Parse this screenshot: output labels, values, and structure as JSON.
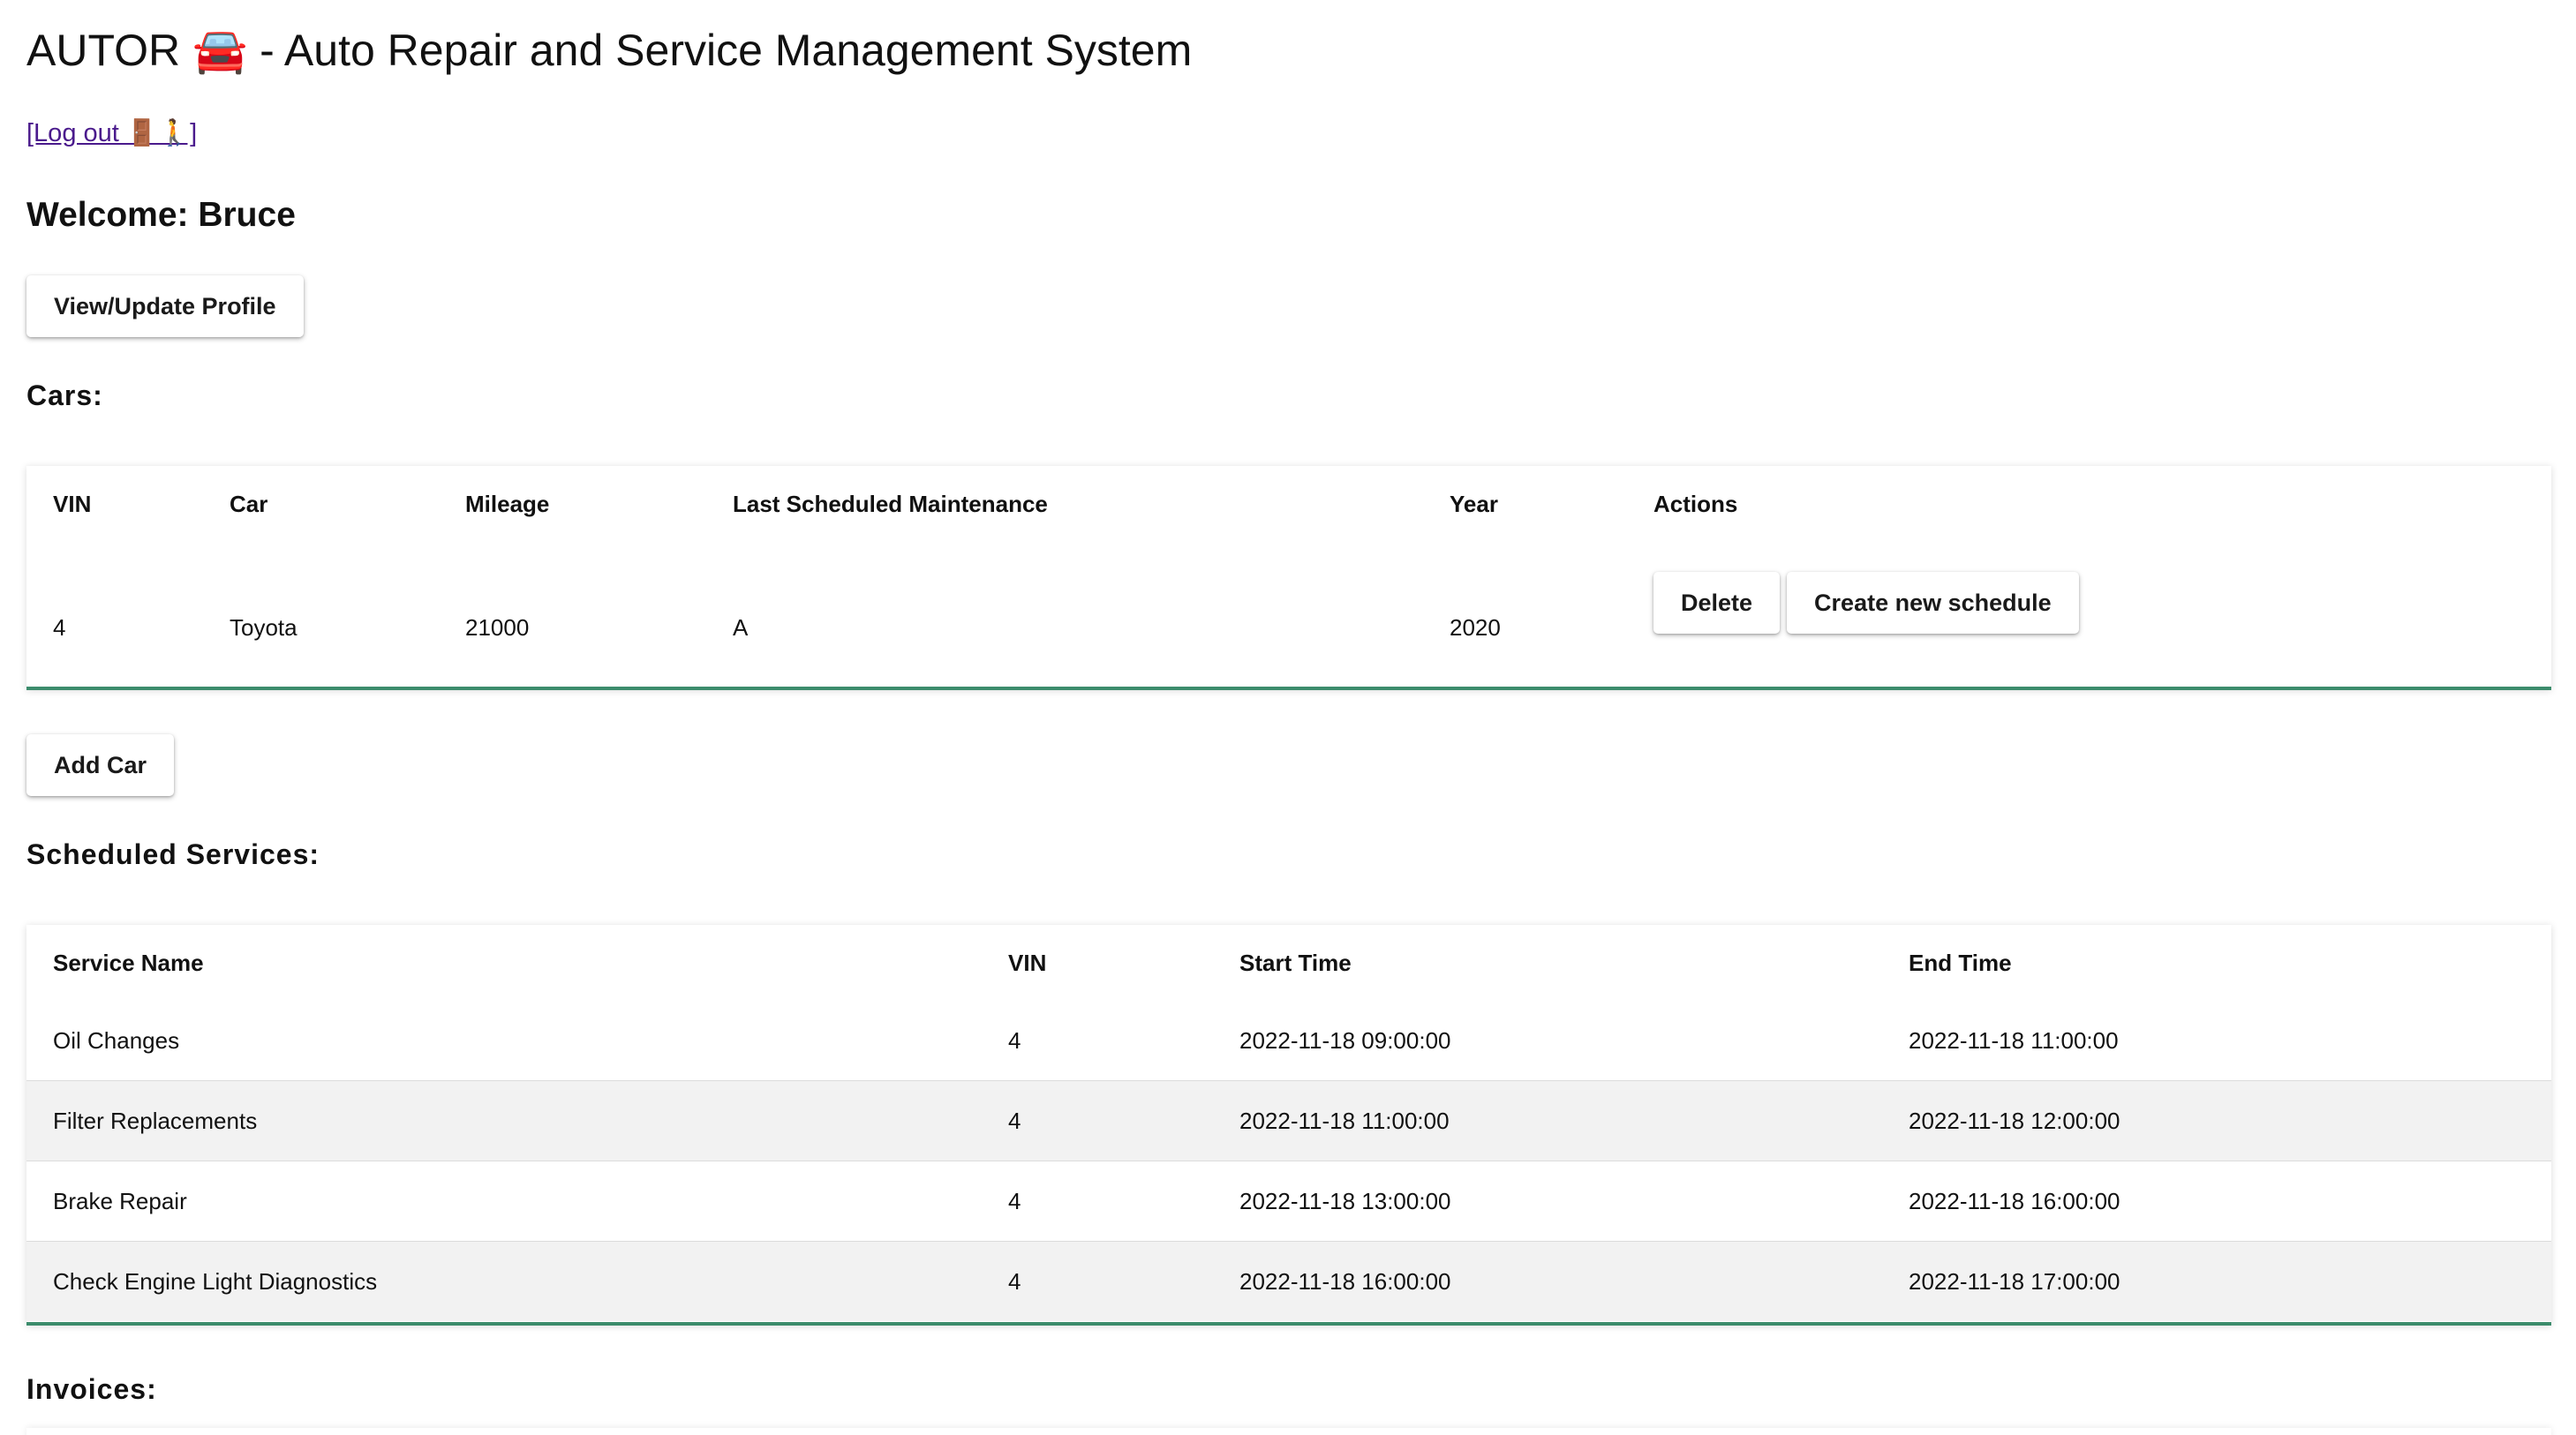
{
  "header": {
    "title": "AUTOR 🚘 - Auto Repair and Service Management System",
    "logout_label": "[Log out 🚪🚶]",
    "welcome": "Welcome: Bruce",
    "profile_button": "View/Update Profile"
  },
  "cars": {
    "heading": "Cars:",
    "columns": [
      "VIN",
      "Car",
      "Mileage",
      "Last Scheduled Maintenance",
      "Year",
      "Actions"
    ],
    "rows": [
      {
        "vin": "4",
        "car": "Toyota",
        "mileage": "21000",
        "last_maintenance": "A",
        "year": "2020",
        "delete_label": "Delete",
        "schedule_label": "Create new schedule"
      }
    ],
    "add_button": "Add Car"
  },
  "services": {
    "heading": "Scheduled Services:",
    "columns": [
      "Service Name",
      "VIN",
      "Start Time",
      "End Time"
    ],
    "rows": [
      {
        "name": "Oil Changes",
        "vin": "4",
        "start": "2022-11-18 09:00:00",
        "end": "2022-11-18 11:00:00"
      },
      {
        "name": "Filter Replacements",
        "vin": "4",
        "start": "2022-11-18 11:00:00",
        "end": "2022-11-18 12:00:00"
      },
      {
        "name": "Brake Repair",
        "vin": "4",
        "start": "2022-11-18 13:00:00",
        "end": "2022-11-18 16:00:00"
      },
      {
        "name": "Check Engine Light Diagnostics",
        "vin": "4",
        "start": "2022-11-18 16:00:00",
        "end": "2022-11-18 17:00:00"
      }
    ]
  },
  "invoices": {
    "heading": "Invoices:"
  },
  "colors": {
    "link": "#4a1a8c",
    "table_accent": "#3c8c6c",
    "row_alt": "#f2f2f2"
  }
}
